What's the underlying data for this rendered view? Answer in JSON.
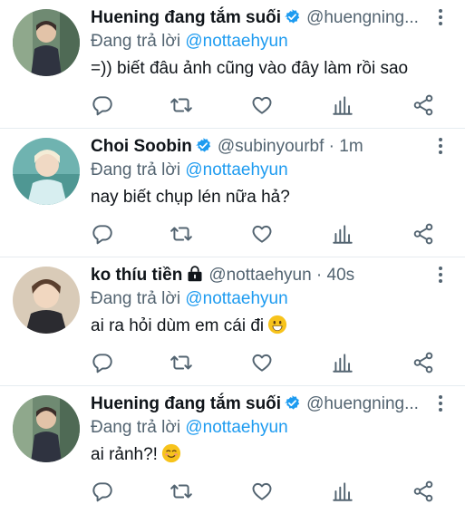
{
  "colors": {
    "accent": "#1d9bf0",
    "secondary_text": "#536471",
    "verified": "#1d9bf0"
  },
  "icons": [
    "verified-badge-icon",
    "lock-icon",
    "more-options-icon",
    "reply-icon",
    "retweet-icon",
    "like-icon",
    "analytics-icon",
    "share-icon"
  ],
  "tweets": [
    {
      "name": "Huening đang tắm suối",
      "verified": true,
      "handle": "@huengning...",
      "meta": "",
      "replying_to_label": "Đang trả lời",
      "replying_to_handle": "@nottaehyun",
      "text": "=)) biết đâu ảnh cũng vào đây làm rồi sao",
      "emoji": ""
    },
    {
      "name": "Choi Soobin",
      "verified": true,
      "handle": "@subinyourbf",
      "meta": " · 1m",
      "replying_to_label": "Đang trả lời",
      "replying_to_handle": "@nottaehyun",
      "text": "nay biết chụp lén nữa hả?",
      "emoji": ""
    },
    {
      "name": "ko thíu tiền",
      "verified": false,
      "locked": true,
      "handle": "@nottaehyun",
      "meta": " · 40s",
      "replying_to_label": "Đang trả lời",
      "replying_to_handle": "@nottaehyun",
      "text": "ai ra hỏi dùm em cái đi",
      "emoji": "grinning-face"
    },
    {
      "name": "Huening đang tắm suối",
      "verified": true,
      "handle": "@huengning...",
      "meta": "",
      "replying_to_label": "Đang trả lời",
      "replying_to_handle": "@nottaehyun",
      "text": "ai rảnh?!",
      "emoji": "smiling-face-with-blush"
    }
  ]
}
